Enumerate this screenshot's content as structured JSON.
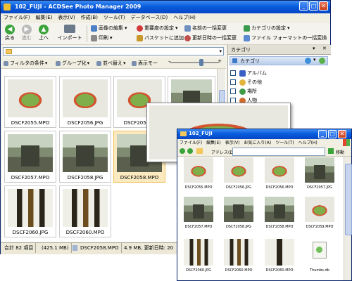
{
  "main_window": {
    "title": "102_FUJI - ACDSee Photo Manager 2009",
    "menu": [
      "ファイル(F)",
      "編集(E)",
      "表示(V)",
      "作成(B)",
      "ツール(T)",
      "データベース(D)",
      "ヘルプ(H)"
    ],
    "nav": {
      "back": "戻る",
      "forward": "進む",
      "up": "上へ",
      "import": "インポート"
    },
    "commands": {
      "edit_image": "画像の編集",
      "print": "印刷",
      "set_rating": "重要度の設定",
      "add_basket": "バスケットに追加",
      "batch_rename": "名前の一括変更",
      "batch_datetime": "更新日時の一括変更",
      "set_category": "カテゴリの設定",
      "batch_format": "ファイル フォーマットの一括変換"
    },
    "filter_bar": {
      "filter": "フィルタの条件",
      "group": "グループ化",
      "sort": "並べ替え",
      "view": "表示モー"
    },
    "thumbnails": [
      {
        "name": "DSCF2055.MPO",
        "photo": "bowl"
      },
      {
        "name": "DSCF2056.JPG",
        "photo": "bowl"
      },
      {
        "name": "DSCF2056.M",
        "photo": "bowl"
      },
      {
        "name": "",
        "photo": "temple"
      },
      {
        "name": "DSCF2057.MPO",
        "photo": "temple"
      },
      {
        "name": "DSCF2058.JPG",
        "photo": "temple"
      },
      {
        "name": "DSCF2058.MPO",
        "photo": "temple"
      },
      {
        "name": "DSCF2060.JPG",
        "photo": "bottles"
      },
      {
        "name": "DSCF2060.MPO",
        "photo": "bottles"
      }
    ],
    "status": {
      "total": "合計 82 項目",
      "size": "(425.1 MB)",
      "selected": "DSCF2058.MPO",
      "info": "4.9 MB, 更新日時: 20"
    }
  },
  "category_panel": {
    "title": "カテゴリ",
    "header": "カテゴリ",
    "items": [
      "アルバム",
      "その他",
      "場所",
      "人物"
    ]
  },
  "explorer_window": {
    "title": "102_FUJI",
    "menu": [
      "ファイル(F)",
      "編集(E)",
      "表示(V)",
      "お気に入り(A)",
      "ツール(T)",
      "ヘルプ(H)"
    ],
    "address_label": "アドレス(D)",
    "go_label": "移動",
    "files": [
      {
        "name": "DSCF2055.MPO",
        "photo": "bowl"
      },
      {
        "name": "DSCF2056.JPG",
        "photo": "bowl"
      },
      {
        "name": "DSCF2056.MPO",
        "photo": "bowl"
      },
      {
        "name": "DSCF2057.JPG",
        "photo": "temple"
      },
      {
        "name": "DSCF2057.MPO",
        "photo": "temple"
      },
      {
        "name": "DSCF2058.JPG",
        "photo": "temple"
      },
      {
        "name": "DSCF2058.MPO",
        "photo": "temple"
      },
      {
        "name": "DSCF2059.MPO",
        "photo": "bowl"
      },
      {
        "name": "DSCF2060.JPG",
        "photo": "bottles"
      },
      {
        "name": "DSCF2060.MPO",
        "photo": "bottles"
      },
      {
        "name": "DSCF2060.MPO",
        "photo": "bottle1"
      },
      {
        "name": "Thumbs.db",
        "photo": "none"
      }
    ]
  }
}
